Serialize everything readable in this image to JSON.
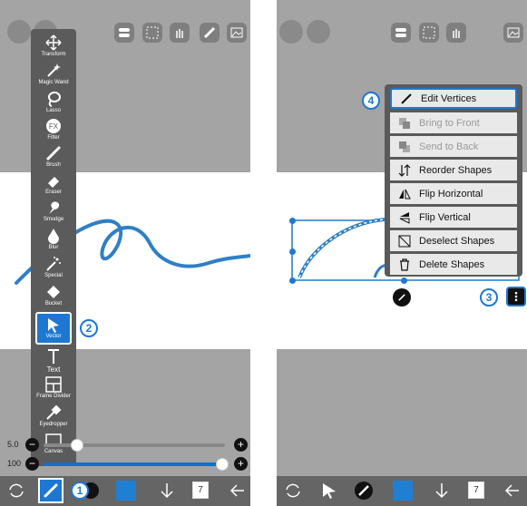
{
  "left_panel": {
    "tools": [
      {
        "label": "Transform",
        "icon": "move-arrows-icon"
      },
      {
        "label": "Magic Wand",
        "icon": "magic-wand-icon"
      },
      {
        "label": "Lasso",
        "icon": "lasso-icon"
      },
      {
        "label": "Filter",
        "icon": "filter-fx-icon"
      },
      {
        "label": "Brush",
        "icon": "brush-icon"
      },
      {
        "label": "Eraser",
        "icon": "eraser-icon"
      },
      {
        "label": "Smudge",
        "icon": "smudge-icon"
      },
      {
        "label": "Blur",
        "icon": "blur-drop-icon"
      },
      {
        "label": "Special",
        "icon": "special-wand-icon"
      },
      {
        "label": "Bucket",
        "icon": "bucket-icon"
      },
      {
        "label": "Vector",
        "icon": "vector-arrow-icon",
        "selected": true
      },
      {
        "label": "Text",
        "icon": "text-icon"
      },
      {
        "label": "Frame Divider",
        "icon": "frame-divider-icon"
      },
      {
        "label": "Eyedropper",
        "icon": "eyedropper-icon"
      },
      {
        "label": "Canvas",
        "icon": "canvas-icon"
      }
    ],
    "brush_size_value": "5.0",
    "opacity_value": "100",
    "badge_1": "1",
    "badge_2": "2",
    "layers_count": "7",
    "color": "#1e7fd3"
  },
  "right_panel": {
    "badge_3": "3",
    "badge_4": "4",
    "layers_count": "7",
    "context_menu": [
      {
        "label": "Edit Vertices",
        "icon": "pen-icon",
        "enabled": true,
        "highlight": true
      },
      {
        "label": "Bring to Front",
        "icon": "bring-to-front-icon",
        "enabled": false
      },
      {
        "label": "Send to Back",
        "icon": "send-to-back-icon",
        "enabled": false
      },
      {
        "label": "Reorder Shapes",
        "icon": "reorder-arrows-icon",
        "enabled": true
      },
      {
        "label": "Flip Horizontal",
        "icon": "flip-horizontal-icon",
        "enabled": true
      },
      {
        "label": "Flip Vertical",
        "icon": "flip-vertical-icon",
        "enabled": true
      },
      {
        "label": "Deselect Shapes",
        "icon": "deselect-icon",
        "enabled": true
      },
      {
        "label": "Delete Shapes",
        "icon": "trash-icon",
        "enabled": true
      }
    ],
    "color": "#1e7fd3"
  }
}
